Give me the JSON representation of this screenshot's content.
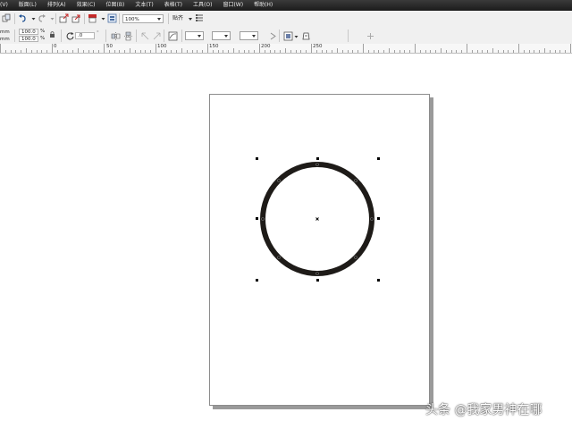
{
  "menubar": {
    "items": [
      "(V)",
      "版面(L)",
      "排列(A)",
      "效果(C)",
      "位图(B)",
      "文本(T)",
      "表格(T)",
      "工具(O)",
      "窗口(W)",
      "帮助(H)"
    ]
  },
  "toolbar": {
    "zoom": "100%",
    "snap_label": "贴齐"
  },
  "property_bar": {
    "unit_a": "mm",
    "unit_b": "mm",
    "scale_x": "100.0",
    "scale_y": "100.0",
    "percent_a": "%",
    "percent_b": "%",
    "rotation": ".0",
    "fill_value": "无",
    "opacity_value": "100"
  },
  "ruler": {
    "labels": [
      "0",
      "50",
      "100",
      "150",
      "200",
      "250"
    ]
  },
  "watermark": "头条 @我家男神在哪",
  "colors": {
    "menubar_bg": "#1b1b1b",
    "circle_stroke": "#1e1b18",
    "handle": "#000000",
    "page_border": "#8c8c8c"
  }
}
